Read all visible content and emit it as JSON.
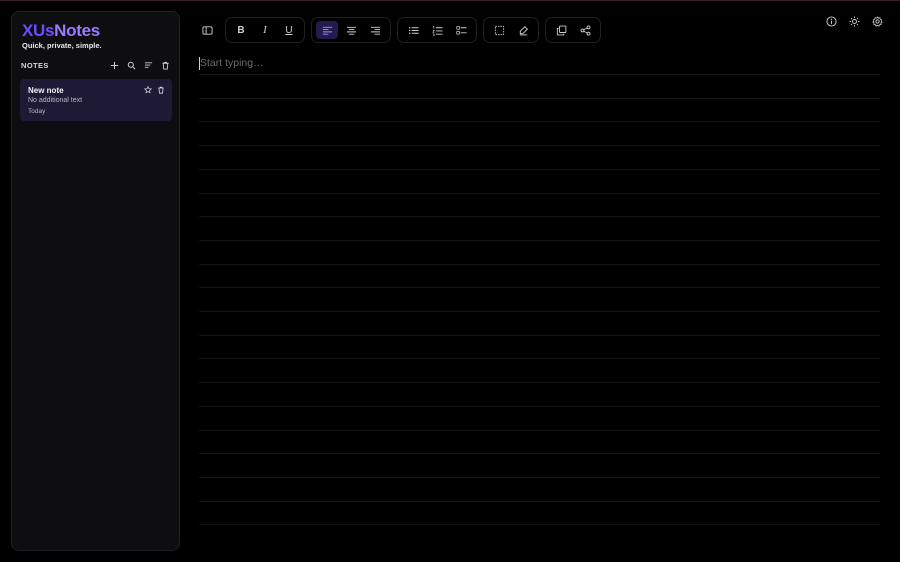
{
  "app": {
    "brand_part1": "XUs",
    "brand_part2": "Notes",
    "tagline": "Quick, private, simple.",
    "accent_color": "#6d4bff"
  },
  "sidebar": {
    "section_label": "NOTES",
    "header_icons": [
      "plus-icon",
      "search-icon",
      "sort-icon",
      "trash-icon"
    ],
    "notes": [
      {
        "title": "New note",
        "preview": "No additional text",
        "date": "Today",
        "selected": true
      }
    ]
  },
  "toolbar": {
    "toggle_sidebar": "sidebar-toggle-icon",
    "bold_label": "B",
    "italic_label": "I",
    "underline_label": "U",
    "alignment_selected": "left",
    "groups": [
      "format",
      "align",
      "lists",
      "select",
      "share"
    ]
  },
  "top_right_icons": [
    "info-icon",
    "sun-icon",
    "gear-icon"
  ],
  "editor": {
    "placeholder": "Start typing…"
  }
}
